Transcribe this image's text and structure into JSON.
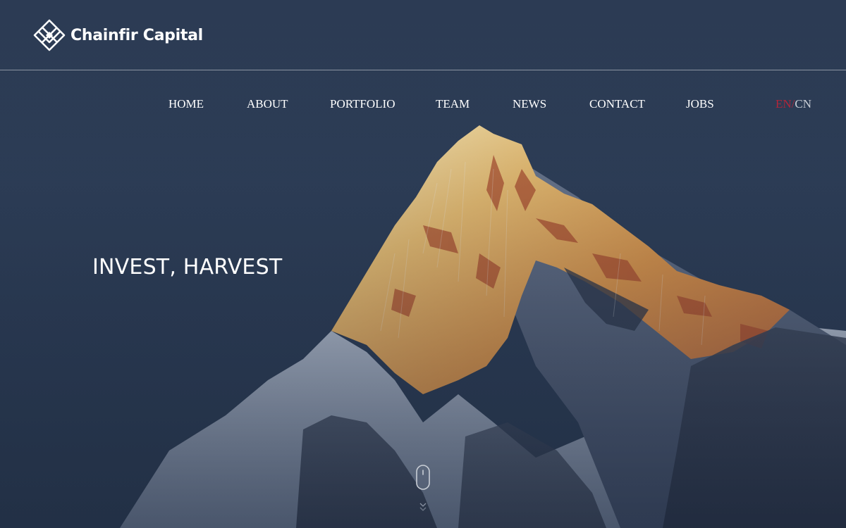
{
  "brand": {
    "name": "Chainfir Capital",
    "logo_icon": "diamond-lattice-logo-icon"
  },
  "nav": {
    "items": [
      {
        "label": "HOME"
      },
      {
        "label": "ABOUT"
      },
      {
        "label": "PORTFOLIO"
      },
      {
        "label": "TEAM"
      },
      {
        "label": "NEWS"
      },
      {
        "label": "CONTACT"
      },
      {
        "label": "JOBS"
      }
    ]
  },
  "language": {
    "en": "EN",
    "separator": "/",
    "cn": "CN",
    "active": "EN",
    "active_color": "#b0263a"
  },
  "hero": {
    "title": "INVEST, HARVEST",
    "background": "snow-capped mountain peak at sunrise",
    "scroll_icon": "mouse-scroll-icon"
  },
  "colors": {
    "sky": "#2c3b54",
    "text": "#ffffff",
    "accent": "#b0263a"
  }
}
